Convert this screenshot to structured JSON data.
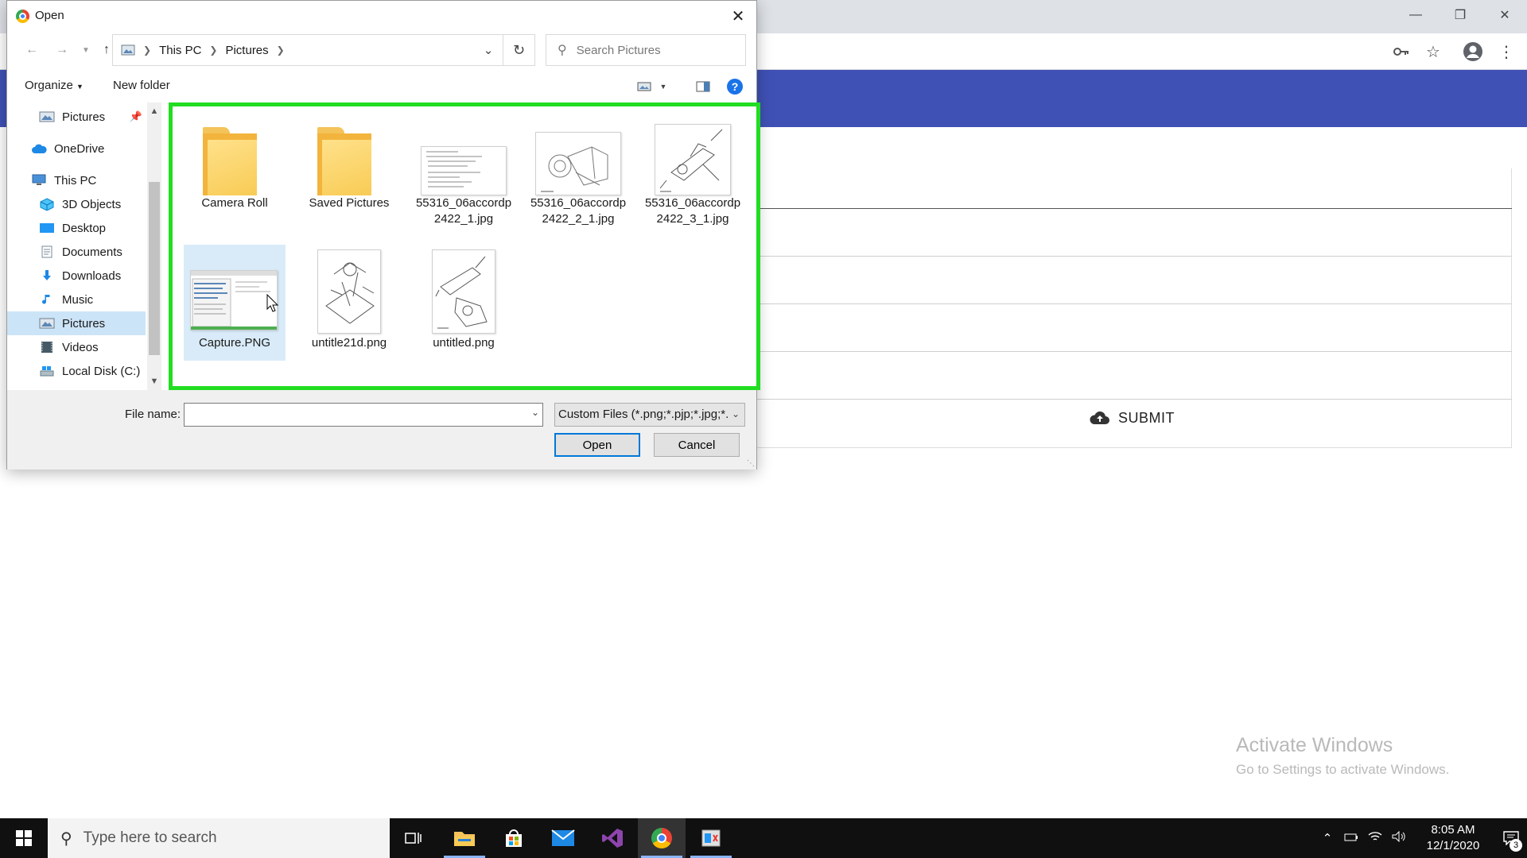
{
  "dialog": {
    "title": "Open",
    "breadcrumbs": [
      "This PC",
      "Pictures"
    ],
    "search_placeholder": "Search Pictures",
    "organize_label": "Organize",
    "new_folder_label": "New folder",
    "help_glyph": "?",
    "nav_items": [
      {
        "label": "Pictures",
        "icon": "pictures-icon",
        "pinned": true
      },
      {
        "label": "OneDrive",
        "icon": "onedrive-icon"
      },
      {
        "label": "This PC",
        "icon": "this-pc-icon"
      },
      {
        "label": "3D Objects",
        "icon": "3d-objects-icon"
      },
      {
        "label": "Desktop",
        "icon": "desktop-icon"
      },
      {
        "label": "Documents",
        "icon": "documents-icon"
      },
      {
        "label": "Downloads",
        "icon": "downloads-icon"
      },
      {
        "label": "Music",
        "icon": "music-icon"
      },
      {
        "label": "Pictures",
        "icon": "pictures-icon",
        "selected": true
      },
      {
        "label": "Videos",
        "icon": "videos-icon"
      },
      {
        "label": "Local Disk (C:)",
        "icon": "local-disk-icon"
      }
    ],
    "files": [
      {
        "name": "Camera Roll",
        "kind": "folder"
      },
      {
        "name": "Saved Pictures",
        "kind": "folder"
      },
      {
        "name": "55316_06accordp2422_1.jpg",
        "line1": "55316_06accordp",
        "line2": "2422_1.jpg",
        "kind": "image"
      },
      {
        "name": "55316_06accordp2422_2_1.jpg",
        "line1": "55316_06accordp",
        "line2": "2422_2_1.jpg",
        "kind": "image"
      },
      {
        "name": "55316_06accordp2422_3_1.jpg",
        "line1": "55316_06accordp",
        "line2": "2422_3_1.jpg",
        "kind": "image"
      },
      {
        "name": "Capture.PNG",
        "kind": "image",
        "selected": true
      },
      {
        "name": "untitle21d.png",
        "kind": "image"
      },
      {
        "name": "untitled.png",
        "kind": "image"
      }
    ],
    "file_name_label": "File name:",
    "file_name_value": "",
    "filter_selected": "Custom Files (*.png;*.pjp;*.jpg;*.",
    "open_label": "Open",
    "cancel_label": "Cancel"
  },
  "page": {
    "submit_label": "SUBMIT",
    "watermark_title": "Activate Windows",
    "watermark_sub": "Go to Settings to activate Windows."
  },
  "taskbar": {
    "search_placeholder": "Type here to search",
    "time": "8:05 AM",
    "date": "12/1/2020",
    "notification_count": "3"
  },
  "colors": {
    "highlight_border": "#22dd22",
    "banner": "#3f51b5",
    "selection": "#cce4f7",
    "primary_button_border": "#0078d7"
  }
}
